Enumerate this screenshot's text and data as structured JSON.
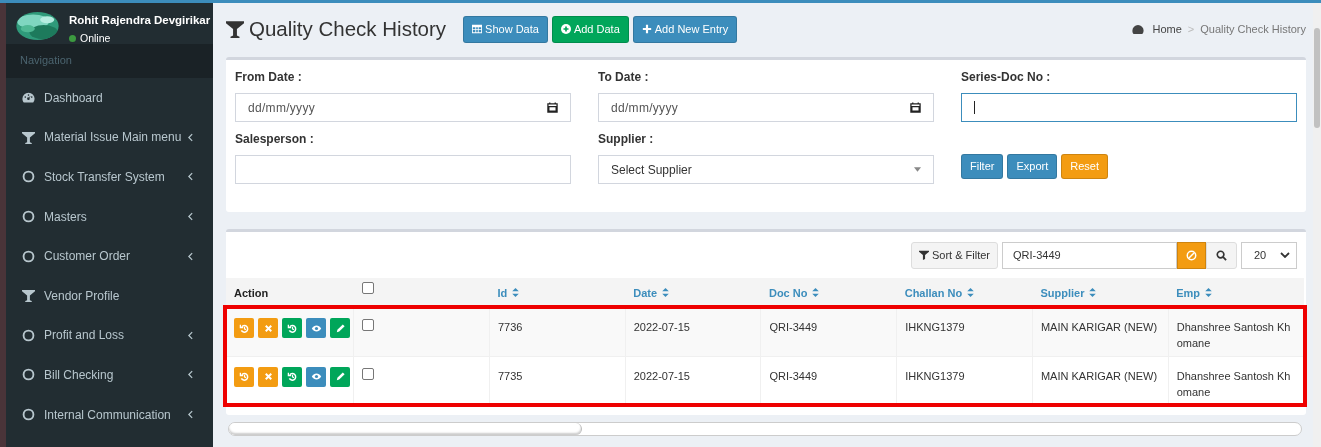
{
  "user": {
    "name": "Rohit Rajendra Devgirikar",
    "status": "Online"
  },
  "sidebar": {
    "heading": "Navigation",
    "items": [
      {
        "label": "Dashboard",
        "kind": "dashboard",
        "has_submenu": false
      },
      {
        "label": "Material Issue Main menu",
        "kind": "filter",
        "has_submenu": true
      },
      {
        "label": "Stock Transfer System",
        "kind": "circle",
        "has_submenu": true
      },
      {
        "label": "Masters",
        "kind": "circle",
        "has_submenu": true
      },
      {
        "label": "Customer Order",
        "kind": "circle",
        "has_submenu": true
      },
      {
        "label": "Vendor Profile",
        "kind": "filter",
        "has_submenu": false
      },
      {
        "label": "Profit and Loss",
        "kind": "circle",
        "has_submenu": true
      },
      {
        "label": "Bill Checking",
        "kind": "circle",
        "has_submenu": true
      },
      {
        "label": "Internal Communication",
        "kind": "circle",
        "has_submenu": true
      }
    ]
  },
  "page_title": "Quality Check History",
  "header_buttons": [
    {
      "label": "Show Data",
      "kind": "table"
    },
    {
      "label": "Add Data",
      "kind": "add"
    },
    {
      "label": "Add New Entry",
      "kind": "plus"
    }
  ],
  "breadcrumb": {
    "home": "Home",
    "separator": ">",
    "current": "Quality Check History"
  },
  "filters": [
    {
      "label": "From Date :",
      "kind": "date",
      "placeholder": "dd/mm/yyyy"
    },
    {
      "label": "To Date :",
      "kind": "date",
      "placeholder": "dd/mm/yyyy"
    },
    {
      "label": "Series-Doc No :",
      "kind": "text",
      "focused": true
    },
    {
      "label": "Salesperson :",
      "kind": "text",
      "focused": false
    },
    {
      "label": "Supplier :",
      "kind": "select",
      "value": "Select Supplier"
    }
  ],
  "filter_buttons": [
    {
      "label": "Filter",
      "kind": "primary"
    },
    {
      "label": "Export",
      "kind": "primary"
    },
    {
      "label": "Reset",
      "kind": "warning"
    }
  ],
  "toolbar": {
    "sort_filter": "Sort & Filter",
    "search_value": "QRI-3449",
    "page_size": "20"
  },
  "table": {
    "highlighted": true,
    "action_label": "Action",
    "select_all_checked": false,
    "columns": [
      {
        "label": "Id",
        "sortable": true
      },
      {
        "label": "Date",
        "sortable": true
      },
      {
        "label": "Doc No",
        "sortable": true
      },
      {
        "label": "Challan No",
        "sortable": true
      },
      {
        "label": "Supplier",
        "sortable": true
      },
      {
        "label": "Emp",
        "sortable": true
      }
    ],
    "rows": [
      {
        "checked": false,
        "cells": [
          "7736",
          "2022-07-15",
          "QRI-3449",
          "IHKNG1379",
          "MAIN KARIGAR (NEW)",
          "Dhanshree Santosh Khomane"
        ]
      },
      {
        "checked": false,
        "cells": [
          "7735",
          "2022-07-15",
          "QRI-3449",
          "IHKNG1379",
          "MAIN KARIGAR (NEW)",
          "Dhanshree Santosh Khomane"
        ]
      }
    ]
  }
}
